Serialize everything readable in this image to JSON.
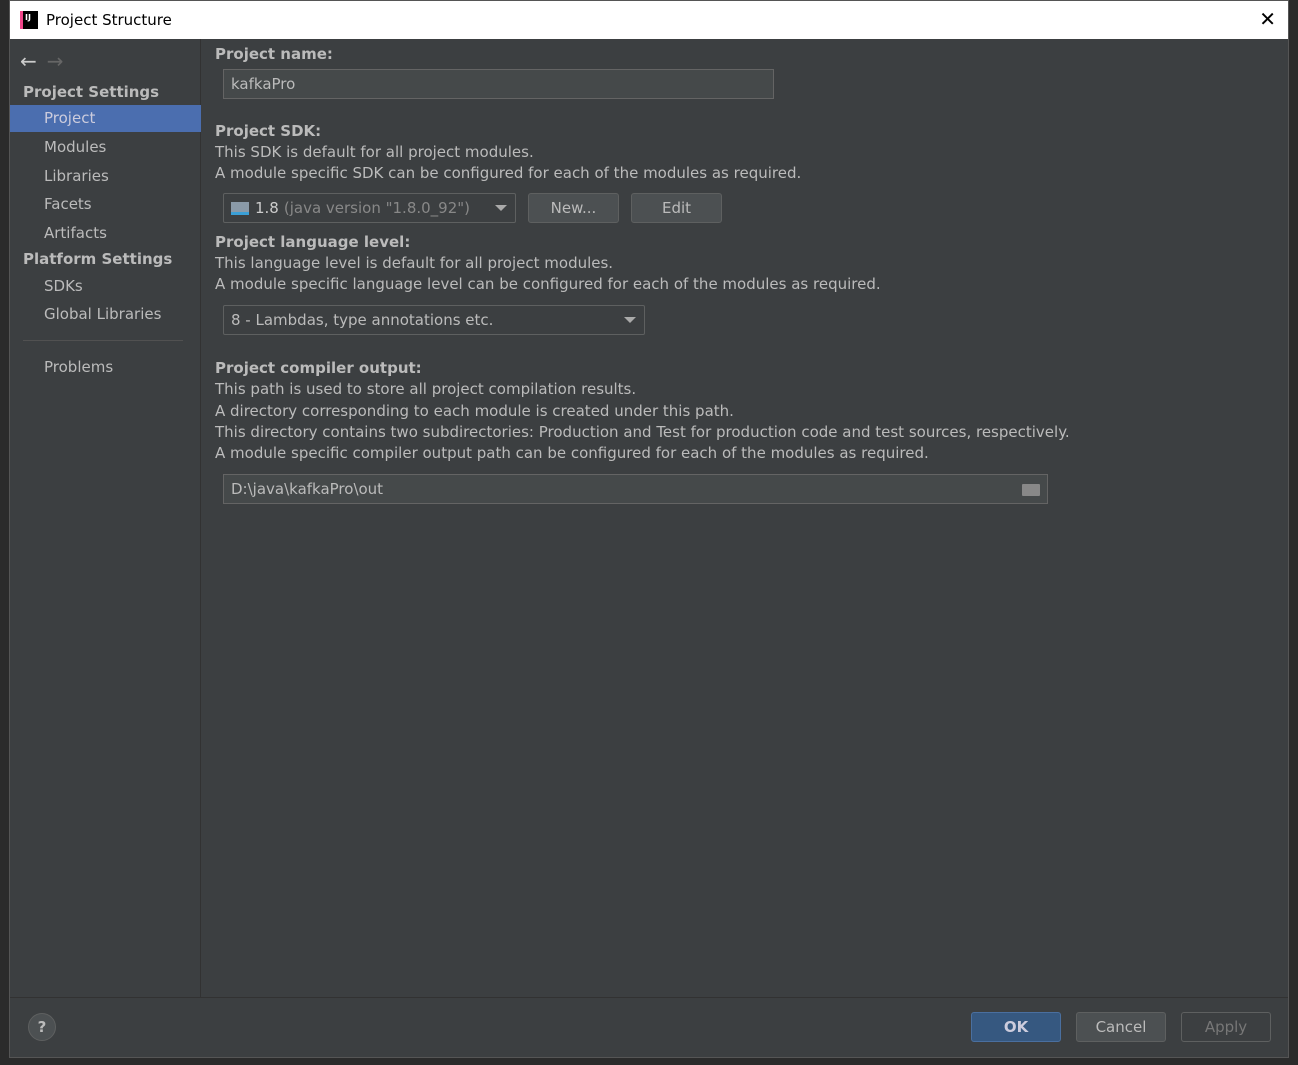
{
  "window": {
    "title": "Project Structure",
    "logo": "IJ"
  },
  "sidebar": {
    "project_settings": "Project Settings",
    "items": [
      {
        "label": "Project"
      },
      {
        "label": "Modules"
      },
      {
        "label": "Libraries"
      },
      {
        "label": "Facets"
      },
      {
        "label": "Artifacts"
      }
    ],
    "platform_settings": "Platform Settings",
    "platform_items": [
      {
        "label": "SDKs"
      },
      {
        "label": "Global Libraries"
      }
    ],
    "problems": "Problems"
  },
  "main": {
    "name_label": "Project name:",
    "name_value": "kafkaPro",
    "sdk_label": "Project SDK:",
    "sdk_desc1": "This SDK is default for all project modules.",
    "sdk_desc2": "A module specific SDK can be configured for each of the modules as required.",
    "sdk_version": "1.8",
    "sdk_detail": "(java version \"1.8.0_92\")",
    "new_button": "New...",
    "edit_button": "Edit",
    "lang_label": "Project language level:",
    "lang_desc1": "This language level is default for all project modules.",
    "lang_desc2": "A module specific language level can be configured for each of the modules as required.",
    "lang_value": "8 - Lambdas, type annotations etc.",
    "out_label": "Project compiler output:",
    "out_desc1": "This path is used to store all project compilation results.",
    "out_desc2": "A directory corresponding to each module is created under this path.",
    "out_desc3": "This directory contains two subdirectories: Production and Test for production code and test sources, respectively.",
    "out_desc4": "A module specific compiler output path can be configured for each of the modules as required.",
    "out_value": "D:\\java\\kafkaPro\\out"
  },
  "footer": {
    "help": "?",
    "ok": "OK",
    "cancel": "Cancel",
    "apply": "Apply"
  }
}
